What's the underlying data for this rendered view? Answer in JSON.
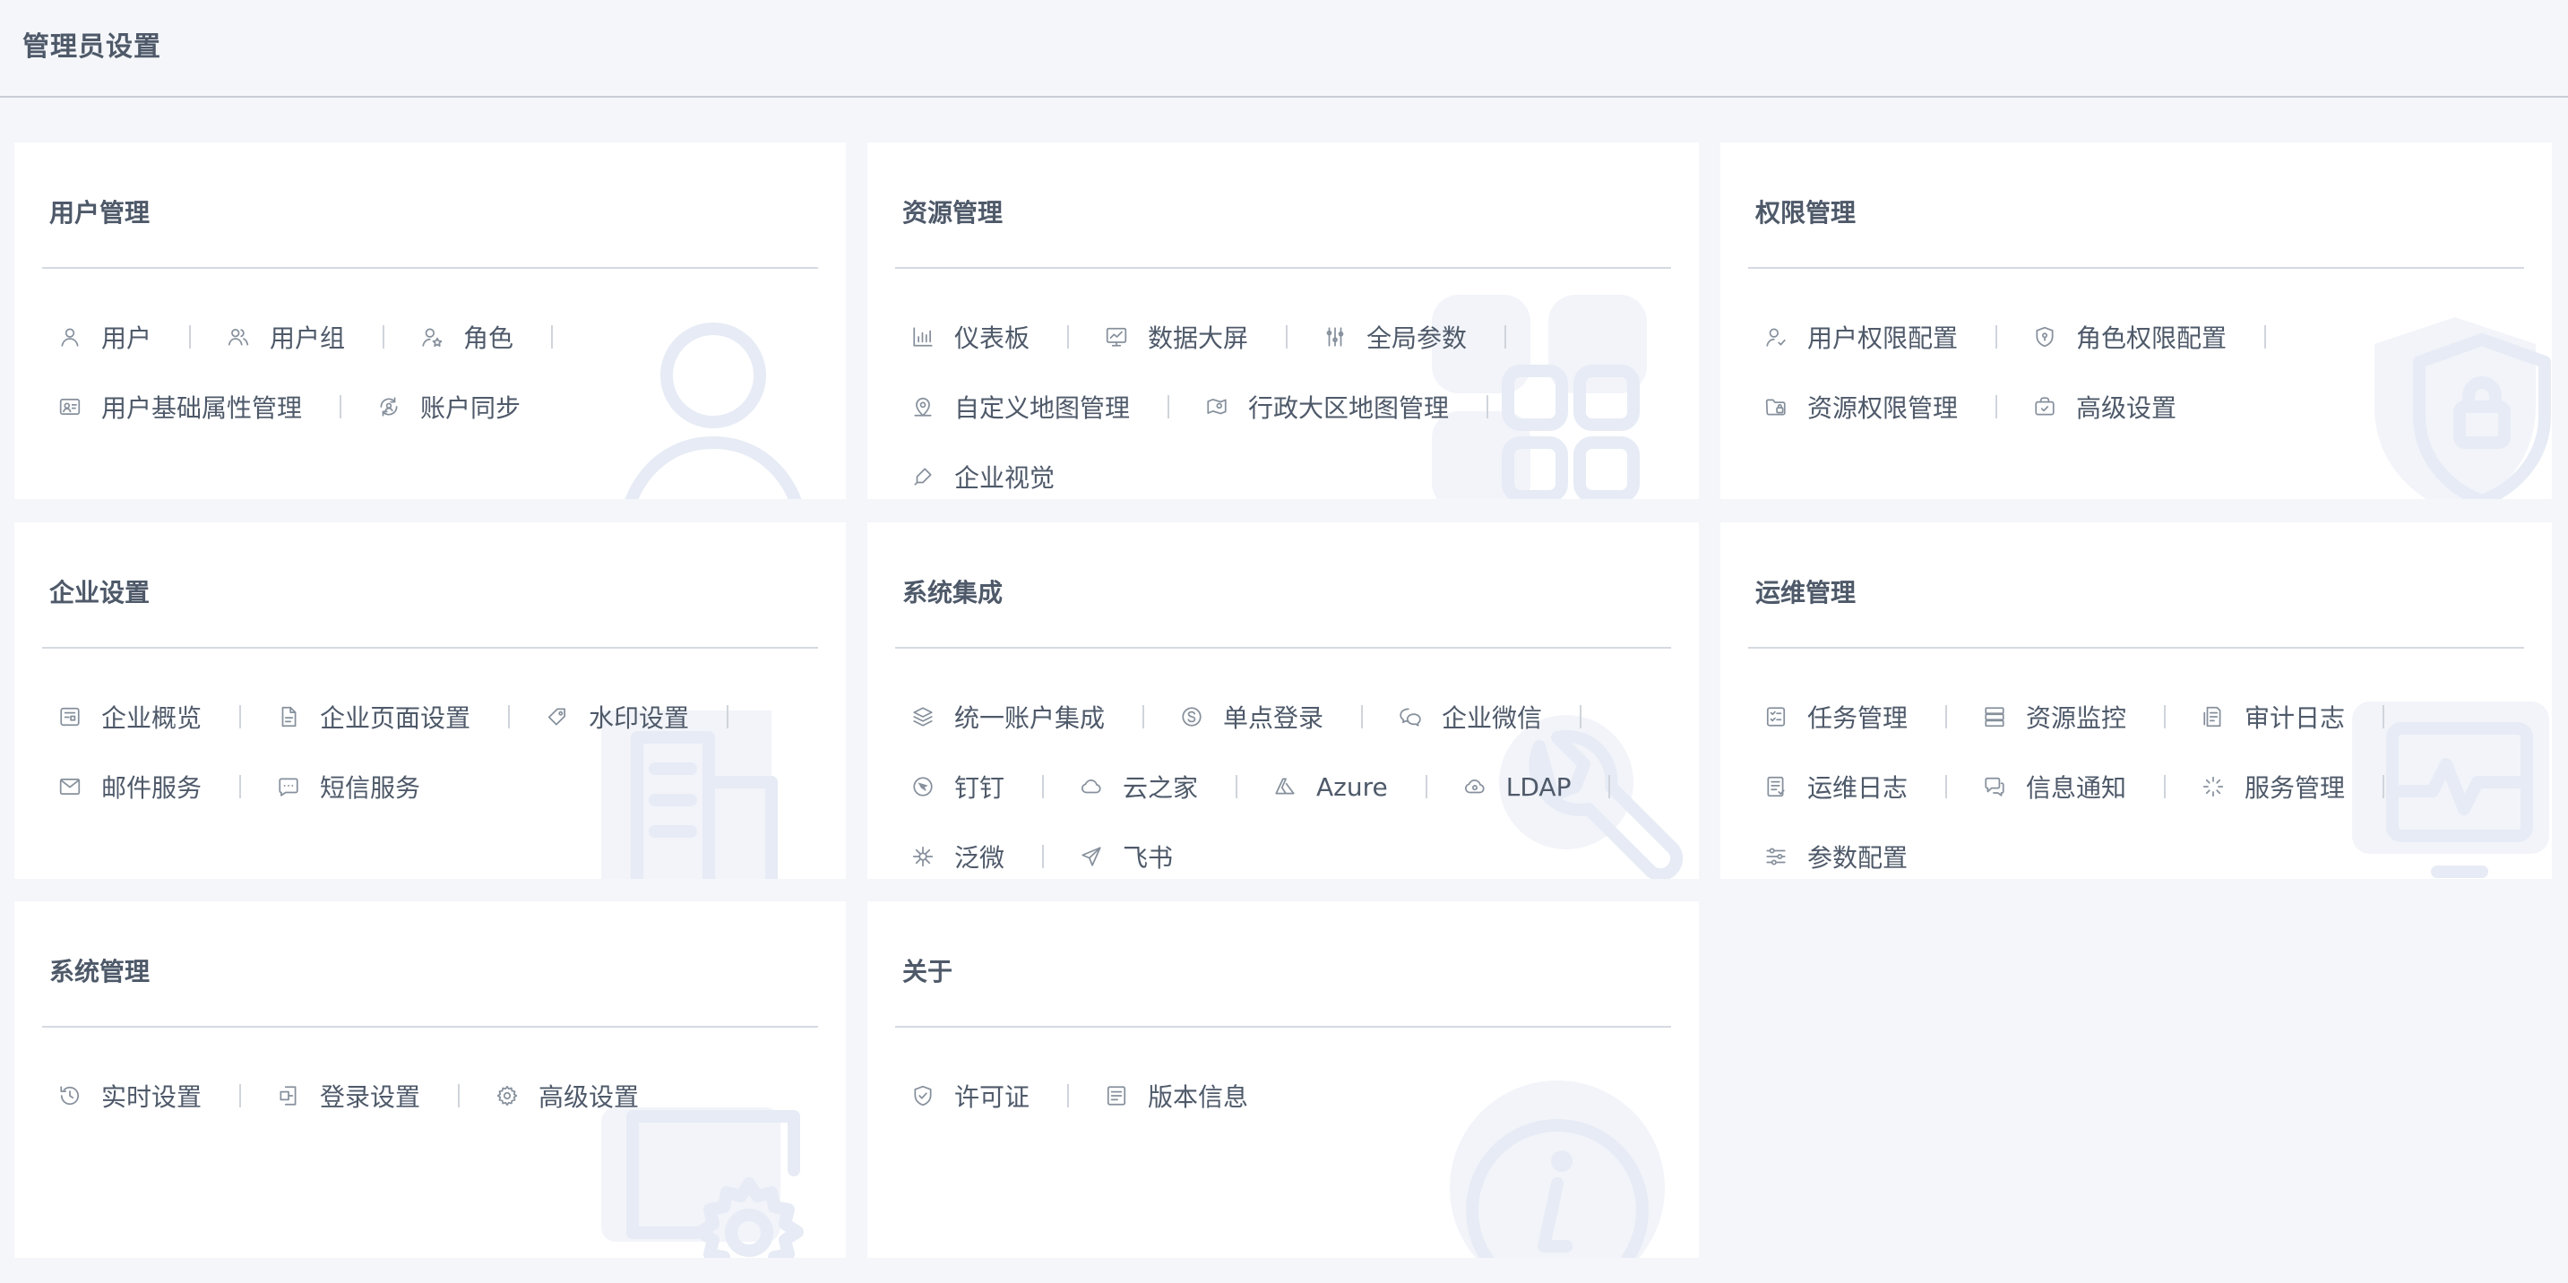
{
  "page": {
    "title": "管理员设置"
  },
  "theme": {
    "accent": "#4e5969",
    "watermark": "#e6ebf5",
    "background": "#f4f6fa"
  },
  "cards": [
    {
      "title": "用户管理",
      "watermark_icon": "user-icon",
      "rows": [
        [
          {
            "label": "用户",
            "icon": "user-icon"
          },
          {
            "label": "用户组",
            "icon": "user-group-icon"
          },
          {
            "label": "角色",
            "icon": "role-icon"
          }
        ],
        [
          {
            "label": "用户基础属性管理",
            "icon": "id-card-icon"
          },
          {
            "label": "账户同步",
            "icon": "account-sync-icon"
          }
        ]
      ]
    },
    {
      "title": "资源管理",
      "watermark_icon": "apps-grid-icon",
      "rows": [
        [
          {
            "label": "仪表板",
            "icon": "bar-chart-icon"
          },
          {
            "label": "数据大屏",
            "icon": "big-screen-icon"
          },
          {
            "label": "全局参数",
            "icon": "sliders-icon"
          }
        ],
        [
          {
            "label": "自定义地图管理",
            "icon": "map-pin-icon"
          },
          {
            "label": "行政大区地图管理",
            "icon": "region-map-icon"
          }
        ],
        [
          {
            "label": "企业视觉",
            "icon": "brush-icon"
          }
        ]
      ]
    },
    {
      "title": "权限管理",
      "watermark_icon": "shield-lock-icon",
      "rows": [
        [
          {
            "label": "用户权限配置",
            "icon": "user-permission-icon"
          },
          {
            "label": "角色权限配置",
            "icon": "shield-icon"
          }
        ],
        [
          {
            "label": "资源权限管理",
            "icon": "folder-lock-icon"
          },
          {
            "label": "高级设置",
            "icon": "advanced-settings-icon"
          }
        ]
      ]
    },
    {
      "title": "企业设置",
      "watermark_icon": "building-icon",
      "rows": [
        [
          {
            "label": "企业概览",
            "icon": "overview-icon"
          },
          {
            "label": "企业页面设置",
            "icon": "page-icon"
          },
          {
            "label": "水印设置",
            "icon": "tag-icon"
          }
        ],
        [
          {
            "label": "邮件服务",
            "icon": "mail-icon"
          },
          {
            "label": "短信服务",
            "icon": "sms-icon"
          }
        ]
      ]
    },
    {
      "title": "系统集成",
      "watermark_icon": "wrench-icon",
      "rows": [
        [
          {
            "label": "统一账户集成",
            "icon": "layers-icon"
          },
          {
            "label": "单点登录",
            "icon": "sso-icon"
          },
          {
            "label": "企业微信",
            "icon": "wecom-icon"
          }
        ],
        [
          {
            "label": "钉钉",
            "icon": "dingtalk-icon"
          },
          {
            "label": "云之家",
            "icon": "cloud-icon"
          },
          {
            "label": "Azure",
            "icon": "azure-icon"
          },
          {
            "label": "LDAP",
            "icon": "ldap-icon"
          }
        ],
        [
          {
            "label": "泛微",
            "icon": "weaver-icon"
          },
          {
            "label": "飞书",
            "icon": "feishu-icon"
          }
        ]
      ]
    },
    {
      "title": "运维管理",
      "watermark_icon": "monitor-pulse-icon",
      "rows": [
        [
          {
            "label": "任务管理",
            "icon": "task-icon"
          },
          {
            "label": "资源监控",
            "icon": "server-icon"
          },
          {
            "label": "审计日志",
            "icon": "audit-log-icon"
          }
        ],
        [
          {
            "label": "运维日志",
            "icon": "ops-log-icon"
          },
          {
            "label": "信息通知",
            "icon": "notification-icon"
          },
          {
            "label": "服务管理",
            "icon": "loader-icon"
          }
        ],
        [
          {
            "label": "参数配置",
            "icon": "params-icon"
          }
        ]
      ]
    },
    {
      "title": "系统管理",
      "watermark_icon": "monitor-gear-icon",
      "rows": [
        [
          {
            "label": "实时设置",
            "icon": "history-icon"
          },
          {
            "label": "登录设置",
            "icon": "login-icon"
          },
          {
            "label": "高级设置",
            "icon": "gear-icon"
          }
        ]
      ]
    },
    {
      "title": "关于",
      "watermark_icon": "info-icon",
      "rows": [
        [
          {
            "label": "许可证",
            "icon": "license-icon"
          },
          {
            "label": "版本信息",
            "icon": "version-icon"
          }
        ]
      ]
    }
  ]
}
